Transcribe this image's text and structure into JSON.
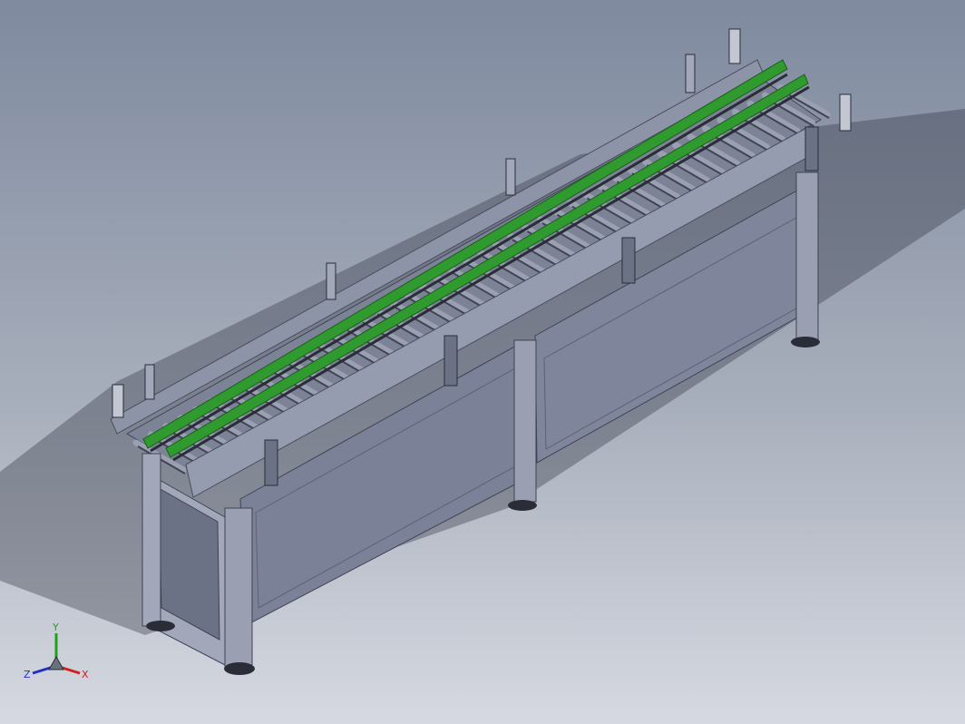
{
  "viewport": {
    "background_top": "#7f8a9f",
    "background_bottom": "#d6d9e1"
  },
  "model": {
    "type": "roller-conveyor",
    "colors": {
      "frame": "#8e94a8",
      "frame_dark": "#5d6274",
      "side_panel": "#7b8196",
      "guide_rail": "#2f9b2f",
      "roller": "#9aa0b2",
      "roller_shadow": "#3f4353"
    }
  },
  "triad": {
    "x_label": "X",
    "y_label": "Y",
    "z_label": "Z",
    "x_color": "#d02020",
    "y_color": "#20a020",
    "z_color": "#2030c0"
  }
}
